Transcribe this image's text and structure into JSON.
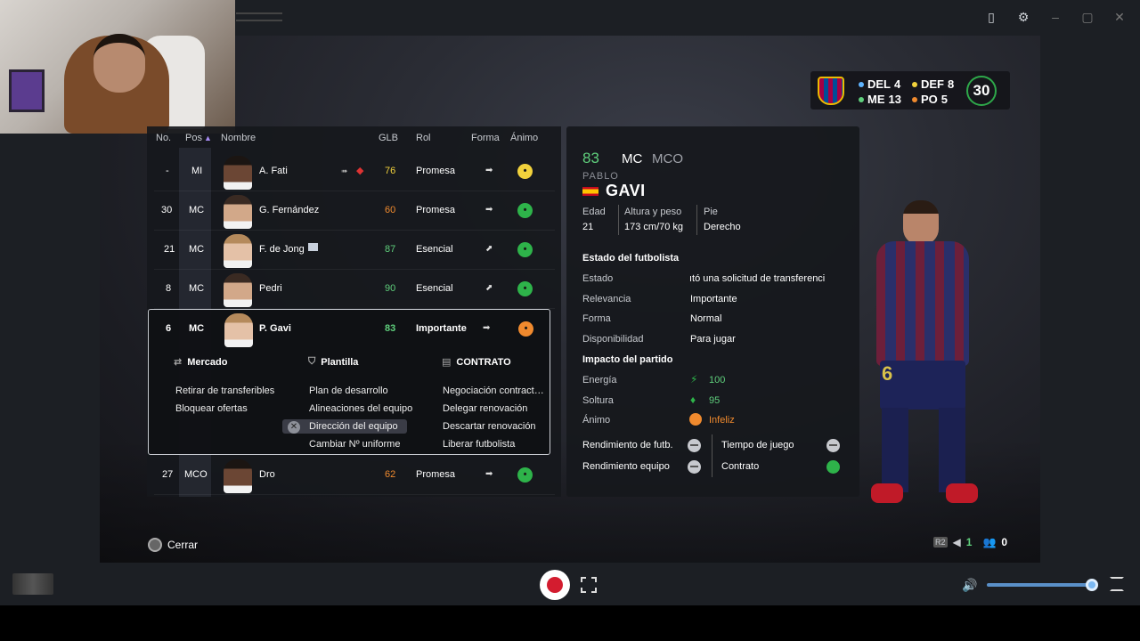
{
  "squad": {
    "items": [
      {
        "label": "DEL",
        "value": "4",
        "color": "#5fb4ff"
      },
      {
        "label": "DEF",
        "value": "8",
        "color": "#f2d23c"
      },
      {
        "label": "ME",
        "value": "13",
        "color": "#5fcf7c"
      },
      {
        "label": "PO",
        "value": "5",
        "color": "#f08a2e"
      }
    ],
    "total": "30"
  },
  "list": {
    "headers": {
      "no": "No.",
      "pos": "Pos",
      "sort_arrow": "▲",
      "name": "Nombre",
      "glb": "GLB",
      "role": "Rol",
      "form": "Forma",
      "mood": "Ánimo"
    },
    "rows": [
      {
        "no": "-",
        "pos": "MI",
        "name": "A. Fati",
        "glb": "76",
        "glb_color": "#f2d23c",
        "role": "Promesa",
        "form": "➡",
        "mood": "yellow"
      },
      {
        "no": "30",
        "pos": "MC",
        "name": "G. Fernández",
        "glb": "60",
        "glb_color": "#f08a2e",
        "role": "Promesa",
        "form": "➡",
        "mood": "green"
      },
      {
        "no": "21",
        "pos": "MC",
        "name": "F. de Jong",
        "glb": "87",
        "glb_color": "#5fcf7c",
        "role": "Esencial",
        "form": "⬈",
        "mood": "green"
      },
      {
        "no": "8",
        "pos": "MC",
        "name": "Pedri",
        "glb": "90",
        "glb_color": "#5fcf7c",
        "role": "Esencial",
        "form": "⬈",
        "mood": "green"
      },
      {
        "no": "6",
        "pos": "MC",
        "name": "P. Gavi",
        "glb": "83",
        "glb_color": "#5fcf7c",
        "role": "Importante",
        "form": "➡",
        "mood": "orange"
      },
      {
        "no": "27",
        "pos": "MCO",
        "name": "Dro",
        "glb": "62",
        "glb_color": "#f08a2e",
        "role": "Promesa",
        "form": "➡",
        "mood": "green"
      }
    ]
  },
  "menu": {
    "mercado": {
      "title": "Mercado",
      "items": [
        "Retirar de transferibles",
        "Bloquear ofertas"
      ]
    },
    "plantilla": {
      "title": "Plantilla",
      "items": [
        "Plan de desarrollo",
        "Alineaciones del equipo",
        "Dirección del equipo",
        "Cambiar Nº uniforme"
      ]
    },
    "contrato": {
      "title": "CONTRATO",
      "items": [
        "Negociación contract…",
        "Delegar renovación",
        "Descartar renovación",
        "Liberar futbolista"
      ]
    }
  },
  "detail": {
    "ovr": "83",
    "pos": "MC",
    "alt_pos": "MCO",
    "first_name": "PABLO",
    "last_name": "GAVI",
    "age_label": "Edad",
    "age": "21",
    "hw_label": "Altura y peso",
    "hw": "173 cm/70 kg",
    "foot_label": "Pie",
    "foot": "Derecho",
    "status_section": "Estado del futbolista",
    "estado_label": "Estado",
    "estado": "ıtó una solicitud de transferenci",
    "relevancia_label": "Relevancia",
    "relevancia": "Importante",
    "forma_label": "Forma",
    "forma": "Normal",
    "disp_label": "Disponibilidad",
    "disp": "Para jugar",
    "impact_section": "Impacto del partido",
    "energia_label": "Energía",
    "energia": "100",
    "soltura_label": "Soltura",
    "soltura": "95",
    "animo_label": "Ánimo",
    "animo": "Infeliz",
    "rend_fut_label": "Rendimiento de futb.",
    "tiempo_label": "Tiempo de juego",
    "rend_eq_label": "Rendimiento equipo",
    "contrato_label": "Contrato"
  },
  "footer": {
    "close_label": "Cerrar",
    "corner_count_a": "1",
    "corner_count_b": "0",
    "jersey_number": "6"
  },
  "colors": {
    "green": "#5fcf7c",
    "orange": "#f08a2e",
    "yellow": "#f2d23c"
  }
}
